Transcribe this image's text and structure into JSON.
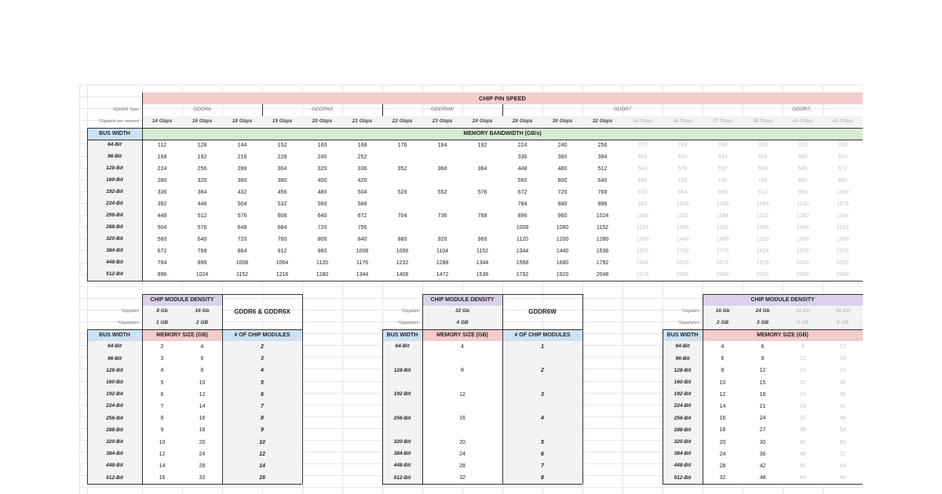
{
  "bandwidth_table": {
    "title": "CHIP PIN SPEED",
    "sdram_label": "SDRAM Type:",
    "speed_label": "*Gigabits per second:",
    "bus_width_header": "BUS WIDTH",
    "bandwidth_header": "MEMORY BANDWIDTH (GB/s)",
    "types": [
      {
        "label": "GDDR6",
        "span": 3
      },
      {
        "label": "GDDR6X",
        "span": 3
      },
      {
        "label": "GDDR6W",
        "span": 3
      },
      {
        "label": "GDDR7",
        "span": 6
      },
      {
        "label": "GDDR7_",
        "span": 3
      }
    ],
    "speeds": [
      "14 Gbps",
      "16 Gbps",
      "18 Gbps",
      "19 Gbps",
      "20 Gbps",
      "21 Gbps",
      "22 Gbps",
      "23 Gbps",
      "24 Gbps",
      "28 Gbps",
      "30 Gbps",
      "32 Gbps",
      "34 Gbps",
      "36 Gbps",
      "37 Gbps",
      "38 Gbps",
      "40 Gbps",
      "42 Gbps"
    ],
    "rows": [
      {
        "bus": "64-Bit",
        "values": [
          "112",
          "128",
          "144",
          "152",
          "160",
          "168",
          "176",
          "184",
          "192",
          "224",
          "240",
          "256",
          "272",
          "288",
          "296",
          "304",
          "320",
          "336"
        ]
      },
      {
        "bus": "96-Bit",
        "values": [
          "168",
          "192",
          "216",
          "228",
          "240",
          "252",
          "",
          "",
          "",
          "336",
          "360",
          "384",
          "408",
          "432",
          "444",
          "456",
          "480",
          "504"
        ]
      },
      {
        "bus": "128-Bit",
        "values": [
          "224",
          "256",
          "288",
          "304",
          "320",
          "336",
          "352",
          "368",
          "384",
          "448",
          "480",
          "512",
          "544",
          "576",
          "592",
          "608",
          "640",
          "672"
        ]
      },
      {
        "bus": "160-Bit",
        "values": [
          "280",
          "320",
          "360",
          "380",
          "400",
          "420",
          "",
          "",
          "",
          "560",
          "600",
          "640",
          "680",
          "720",
          "740",
          "760",
          "800",
          "840"
        ]
      },
      {
        "bus": "192-Bit",
        "values": [
          "336",
          "384",
          "432",
          "456",
          "480",
          "504",
          "528",
          "552",
          "576",
          "672",
          "720",
          "768",
          "816",
          "864",
          "888",
          "912",
          "960",
          "1008"
        ]
      },
      {
        "bus": "224-Bit",
        "values": [
          "392",
          "448",
          "504",
          "532",
          "560",
          "588",
          "",
          "",
          "",
          "784",
          "840",
          "896",
          "952",
          "1008",
          "1036",
          "1064",
          "1120",
          "1176"
        ]
      },
      {
        "bus": "256-Bit",
        "values": [
          "448",
          "512",
          "576",
          "608",
          "640",
          "672",
          "704",
          "736",
          "768",
          "896",
          "960",
          "1024",
          "1088",
          "1152",
          "1184",
          "1216",
          "1280",
          "1344"
        ]
      },
      {
        "bus": "288-Bit",
        "values": [
          "504",
          "576",
          "648",
          "684",
          "720",
          "756",
          "",
          "",
          "",
          "1008",
          "1080",
          "1152",
          "1224",
          "1296",
          "1332",
          "1368",
          "1440",
          "1512"
        ]
      },
      {
        "bus": "320-Bit",
        "values": [
          "560",
          "640",
          "720",
          "760",
          "800",
          "840",
          "880",
          "920",
          "960",
          "1120",
          "1200",
          "1280",
          "1360",
          "1440",
          "1480",
          "1520",
          "1600",
          "1680"
        ]
      },
      {
        "bus": "384-Bit",
        "values": [
          "672",
          "768",
          "864",
          "912",
          "960",
          "1008",
          "1056",
          "1104",
          "1152",
          "1344",
          "1440",
          "1536",
          "1632",
          "1728",
          "1776",
          "1824",
          "1920",
          "2016"
        ]
      },
      {
        "bus": "448-Bit",
        "values": [
          "784",
          "896",
          "1008",
          "1064",
          "1120",
          "1176",
          "1232",
          "1288",
          "1344",
          "1568",
          "1680",
          "1792",
          "1904",
          "2016",
          "2072",
          "2128",
          "2240",
          "2352"
        ]
      },
      {
        "bus": "512-Bit",
        "values": [
          "896",
          "1024",
          "1152",
          "1216",
          "1280",
          "1344",
          "1408",
          "1472",
          "1536",
          "1792",
          "1920",
          "2048",
          "2176",
          "2304",
          "2368",
          "2432",
          "2560",
          "2688"
        ]
      }
    ]
  },
  "module_tables": [
    {
      "density_header": "CHIP MODULE DENSITY",
      "type_title": "GDDR6 & GDDR6X",
      "gigabits_label": "*Gigabits:",
      "gigabytes_label": "*Gigabytes:",
      "gigabits": [
        "8 Gb",
        "16 Gb"
      ],
      "gigabytes": [
        "1 GB",
        "2 GB"
      ],
      "bus_width_header": "BUS WIDTH",
      "memory_header": "MEMORY SIZE (GB)",
      "chips_header": "# OF CHIP MODULES",
      "rows": [
        {
          "bus": "64-Bit",
          "sizes": [
            "2",
            "4"
          ],
          "chips": "2"
        },
        {
          "bus": "96-Bit",
          "sizes": [
            "3",
            "6"
          ],
          "chips": "3"
        },
        {
          "bus": "128-Bit",
          "sizes": [
            "4",
            "8"
          ],
          "chips": "4"
        },
        {
          "bus": "160-Bit",
          "sizes": [
            "5",
            "10"
          ],
          "chips": "5"
        },
        {
          "bus": "192-Bit",
          "sizes": [
            "6",
            "12"
          ],
          "chips": "6"
        },
        {
          "bus": "224-Bit",
          "sizes": [
            "7",
            "14"
          ],
          "chips": "7"
        },
        {
          "bus": "256-Bit",
          "sizes": [
            "8",
            "16"
          ],
          "chips": "8"
        },
        {
          "bus": "288-Bit",
          "sizes": [
            "9",
            "18"
          ],
          "chips": "9"
        },
        {
          "bus": "320-Bit",
          "sizes": [
            "10",
            "20"
          ],
          "chips": "10"
        },
        {
          "bus": "384-Bit",
          "sizes": [
            "12",
            "24"
          ],
          "chips": "12"
        },
        {
          "bus": "448-Bit",
          "sizes": [
            "14",
            "28"
          ],
          "chips": "14"
        },
        {
          "bus": "512-Bit",
          "sizes": [
            "16",
            "32"
          ],
          "chips": "16"
        }
      ]
    },
    {
      "density_header": "CHIP MODULE DENSITY",
      "type_title": "GDDR6W",
      "gigabits_label": "*Gigabits:",
      "gigabytes_label": "*Gigabytes:",
      "gigabits": [
        "32 Gb"
      ],
      "gigabytes": [
        "4 GB"
      ],
      "bus_width_header": "BUS WIDTH",
      "memory_header": "MEMORY SIZE (GB)",
      "chips_header": "# OF CHIP MODULES",
      "rows": [
        {
          "bus": "64-Bit",
          "sizes": [
            "4"
          ],
          "chips": "1"
        },
        {
          "bus": "",
          "sizes": [
            ""
          ],
          "chips": ""
        },
        {
          "bus": "128-Bit",
          "sizes": [
            "8"
          ],
          "chips": "2"
        },
        {
          "bus": "",
          "sizes": [
            ""
          ],
          "chips": ""
        },
        {
          "bus": "192-Bit",
          "sizes": [
            "12"
          ],
          "chips": "3"
        },
        {
          "bus": "",
          "sizes": [
            ""
          ],
          "chips": ""
        },
        {
          "bus": "256-Bit",
          "sizes": [
            "16"
          ],
          "chips": "4"
        },
        {
          "bus": "",
          "sizes": [
            ""
          ],
          "chips": ""
        },
        {
          "bus": "320-Bit",
          "sizes": [
            "20"
          ],
          "chips": "5"
        },
        {
          "bus": "384-Bit",
          "sizes": [
            "24"
          ],
          "chips": "6"
        },
        {
          "bus": "448-Bit",
          "sizes": [
            "28"
          ],
          "chips": "7"
        },
        {
          "bus": "512-Bit",
          "sizes": [
            "32"
          ],
          "chips": "8"
        }
      ]
    },
    {
      "density_header": "CHIP MODULE DENSITY",
      "gigabits_label": "*Gigabits:",
      "gigabytes_label": "*Gigabytes:",
      "gigabits": [
        "16 Gb",
        "24 Gb",
        "32 Gb",
        "48 Gb"
      ],
      "gigabytes": [
        "2 GB",
        "3 GB",
        "4 GB",
        "6 GB"
      ],
      "bus_width_header": "BUS WIDTH",
      "memory_header": "MEMORY SIZE (GB)",
      "rows": [
        {
          "bus": "64-Bit",
          "sizes": [
            "4",
            "6",
            "8",
            "12"
          ]
        },
        {
          "bus": "96-Bit",
          "sizes": [
            "6",
            "9",
            "12",
            "18"
          ]
        },
        {
          "bus": "128-Bit",
          "sizes": [
            "8",
            "12",
            "16",
            "24"
          ]
        },
        {
          "bus": "160-Bit",
          "sizes": [
            "10",
            "15",
            "20",
            "30"
          ]
        },
        {
          "bus": "192-Bit",
          "sizes": [
            "12",
            "18",
            "24",
            "36"
          ]
        },
        {
          "bus": "224-Bit",
          "sizes": [
            "14",
            "21",
            "28",
            "42"
          ]
        },
        {
          "bus": "256-Bit",
          "sizes": [
            "16",
            "24",
            "32",
            "48"
          ]
        },
        {
          "bus": "288-Bit",
          "sizes": [
            "18",
            "27",
            "36",
            "54"
          ]
        },
        {
          "bus": "320-Bit",
          "sizes": [
            "20",
            "30",
            "40",
            "60"
          ]
        },
        {
          "bus": "384-Bit",
          "sizes": [
            "24",
            "36",
            "48",
            "72"
          ]
        },
        {
          "bus": "448-Bit",
          "sizes": [
            "28",
            "42",
            "56",
            "84"
          ]
        },
        {
          "bus": "512-Bit",
          "sizes": [
            "32",
            "48",
            "64",
            "96"
          ]
        }
      ]
    }
  ],
  "colors": {
    "pink_header": "#f4cccc",
    "green_header": "#d9ead3",
    "blue_header": "#cfe2f3",
    "purple_header": "#d9d2e9",
    "gray_cell": "#f3f3f3",
    "faded_text": "#c4c4c4"
  }
}
